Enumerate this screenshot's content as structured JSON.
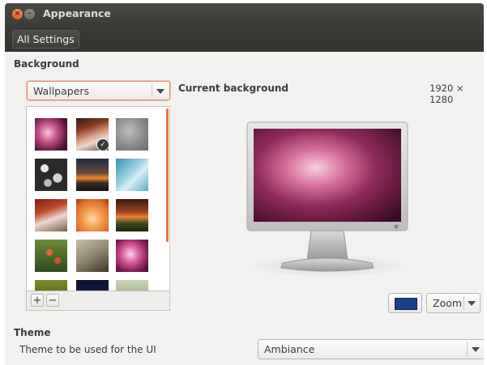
{
  "window": {
    "title": "Appearance",
    "close_glyph": "×",
    "minimize_glyph": "–"
  },
  "toolbar": {
    "all_settings_label": "All Settings"
  },
  "background": {
    "section_title": "Background",
    "source_selected": "Wallpapers",
    "current_label": "Current background",
    "resolution": "1920 × 1280",
    "add_label": "+",
    "remove_label": "−",
    "selected_wallpaper_index": 1,
    "wallpapers": [
      "purple-bokeh",
      "autumn-path-selected",
      "grey-deer",
      "rock-pebbles",
      "sunset-lake",
      "blue-ice",
      "red-trees-road",
      "orange-leaves",
      "sunset-field",
      "red-flowers",
      "pen-paper",
      "pink-flower",
      "yellow-green-field",
      "night-sky",
      "meadow"
    ],
    "color_swatch": "#1a3f8a",
    "scale_selected": "Zoom"
  },
  "theme": {
    "section_title": "Theme",
    "label": "Theme to be used for the UI",
    "selected": "Ambiance"
  },
  "colors": {
    "accent": "#e9763f",
    "titlebar": "#3c3b37",
    "window_bg": "#f2f1f0"
  }
}
